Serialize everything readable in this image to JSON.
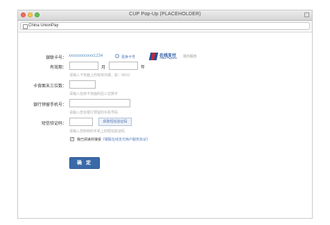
{
  "window": {
    "title": "CUP Pop-Up (PLACEHOLDER)"
  },
  "address": {
    "url_text": "China UnionPay"
  },
  "card": {
    "label": "银联卡号：",
    "number": "xxxxxxxxxxxx1234",
    "switch_link": "更换卡号"
  },
  "logo": {
    "main": "在线支付",
    "sub": "Online Payment",
    "side_text": "境外服务"
  },
  "expiry": {
    "label": "有效期：",
    "month_unit": "月",
    "year_unit": "年",
    "hint": "请输入卡背面上的有效日期，如：09/12"
  },
  "cvn": {
    "label": "卡背面末三位数：",
    "hint": "请输入信用卡背面的后三位数字"
  },
  "phone": {
    "label": "银行预留手机号：",
    "hint": "请输入您在银行预留的手机号码"
  },
  "sms": {
    "label": "短信验证码：",
    "button": "获取短信验证码",
    "hint": "请输入您收到的手机上的短信验证码"
  },
  "agreement": {
    "check_mark": "✓",
    "text": "我已阅读并接受",
    "link": "《银联在线支付用户服务协议》"
  },
  "submit": {
    "label": "确 定"
  }
}
